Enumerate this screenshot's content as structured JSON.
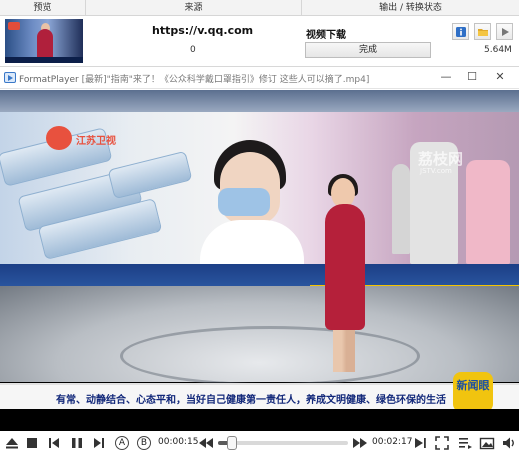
{
  "task_table": {
    "headers": {
      "preview": "预览",
      "source": "来源",
      "output_status": "输出 / 转换状态"
    },
    "row": {
      "source_url": "https://v.qq.com",
      "source_count": "0",
      "task_name": "视频下载",
      "status": "完成",
      "file_size": "5.64M"
    }
  },
  "player": {
    "app_name": "FormatPlayer",
    "file_title": "[最新]\"指南\"来了！《公众科学戴口罩指引》修订 这些人可以摘了.mp4]",
    "window_buttons": [
      "—",
      "☐",
      "✕"
    ],
    "video": {
      "ticker": "有常、动静结合、心态平和，当好自己健康第一责任人，养成文明健康、绿色环保的生活",
      "watermark": "荔枝网",
      "watermark_sub": "JSTV.com",
      "screen_logo": "江苏卫视",
      "badge": "新闻眼"
    },
    "controls": {
      "current_time": "00:00:15",
      "total_time": "00:02:17",
      "a_marker": "A",
      "b_marker": "B",
      "progress": 0.11
    }
  },
  "colors": {
    "accent": "#3a78c8",
    "anchor_dress": "#b5203a",
    "ticker_text": "#12287a"
  }
}
